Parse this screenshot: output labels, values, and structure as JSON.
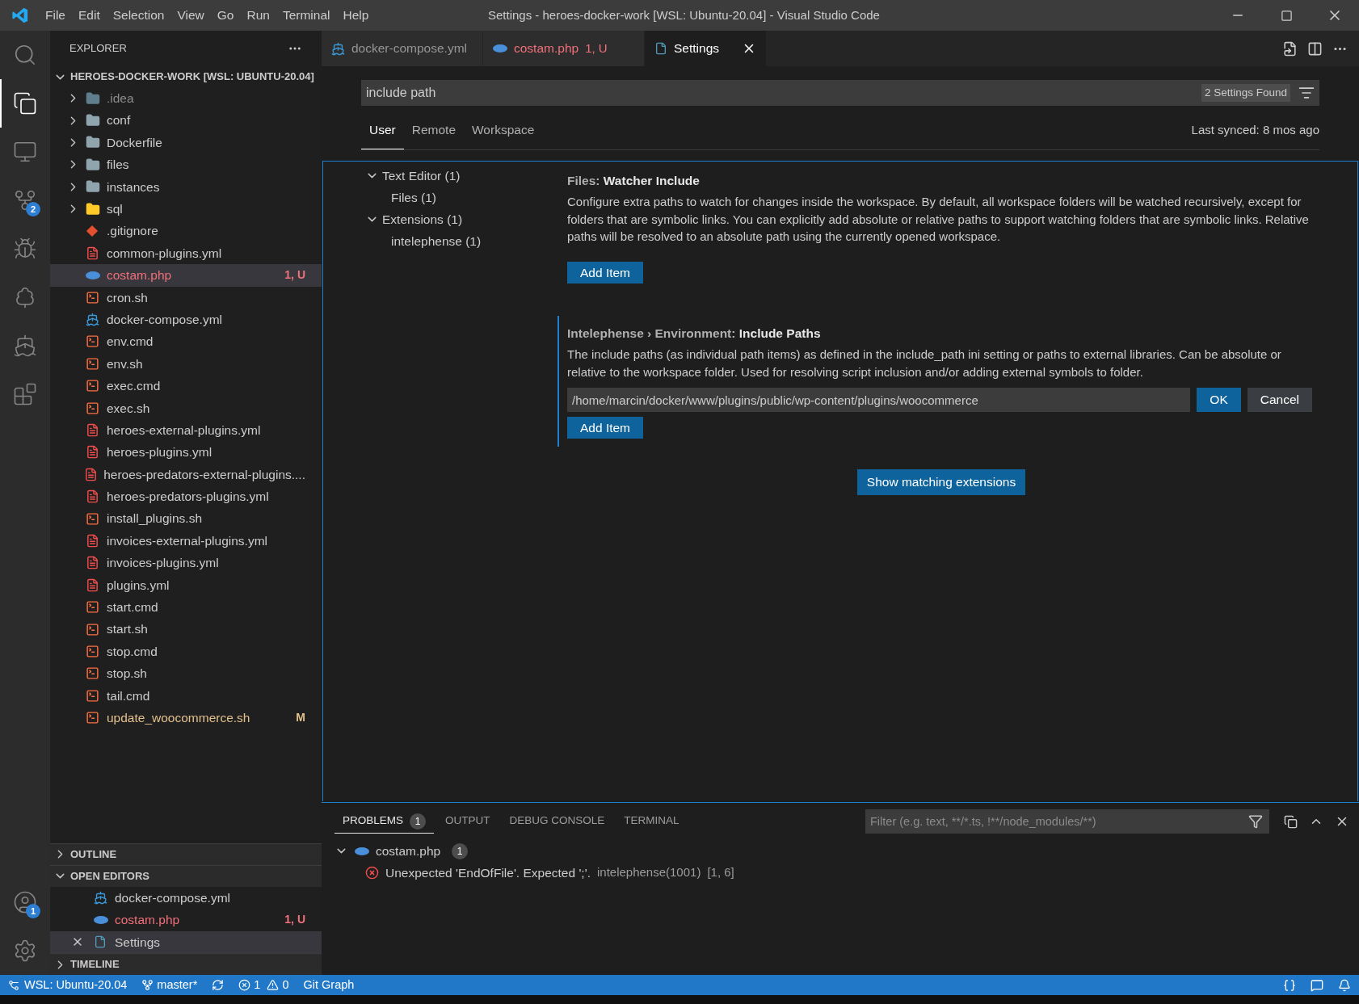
{
  "title_bar": {
    "menu": [
      "File",
      "Edit",
      "Selection",
      "View",
      "Go",
      "Run",
      "Terminal",
      "Help"
    ],
    "title": "Settings - heroes-docker-work [WSL: Ubuntu-20.04] - Visual Studio Code"
  },
  "activity_bar": {
    "items": [
      {
        "kind": "search",
        "selected": false
      },
      {
        "kind": "explorer",
        "selected": true
      },
      {
        "kind": "remote",
        "selected": false
      },
      {
        "kind": "source-control",
        "selected": false,
        "badge": "2"
      },
      {
        "kind": "run",
        "selected": false
      },
      {
        "kind": "testing",
        "selected": false
      },
      {
        "kind": "docker",
        "selected": false
      },
      {
        "kind": "extensions",
        "selected": false
      }
    ],
    "bottom": [
      {
        "kind": "accounts",
        "badge": "1"
      },
      {
        "kind": "manage"
      }
    ]
  },
  "explorer": {
    "title": "EXPLORER",
    "root": {
      "label": "HEROES-DOCKER-WORK [WSL: UBUNTU-20.04]",
      "expanded": true
    },
    "files": [
      {
        "name": ".idea",
        "kind": "idea-folder",
        "expanded": false,
        "color": "#8c8c8c",
        "selected": false
      },
      {
        "name": "conf",
        "kind": "folder",
        "expanded": false,
        "color": "#cccccc",
        "selected": false
      },
      {
        "name": "Dockerfile",
        "kind": "folder",
        "expanded": false,
        "color": "#cccccc",
        "selected": false
      },
      {
        "name": "files",
        "kind": "folder",
        "expanded": false,
        "color": "#cccccc",
        "selected": false
      },
      {
        "name": "instances",
        "kind": "folder",
        "expanded": false,
        "color": "#cccccc",
        "selected": false
      },
      {
        "name": "sql",
        "kind": "sql-folder",
        "expanded": false,
        "color": "#cccccc",
        "selected": false
      },
      {
        "name": ".gitignore",
        "kind": "git",
        "color": "#cccccc",
        "selected": false
      },
      {
        "name": "common-plugins.yml",
        "kind": "yaml",
        "color": "#cccccc",
        "selected": false
      },
      {
        "name": "costam.php",
        "kind": "php",
        "color": "#f1707b",
        "decoration": "1, U",
        "selected": true
      },
      {
        "name": "cron.sh",
        "kind": "shell",
        "color": "#cccccc",
        "selected": false
      },
      {
        "name": "docker-compose.yml",
        "kind": "docker",
        "color": "#cccccc",
        "selected": false
      },
      {
        "name": "env.cmd",
        "kind": "shell",
        "color": "#cccccc",
        "selected": false
      },
      {
        "name": "env.sh",
        "kind": "shell",
        "color": "#cccccc",
        "selected": false
      },
      {
        "name": "exec.cmd",
        "kind": "shell",
        "color": "#cccccc",
        "selected": false
      },
      {
        "name": "exec.sh",
        "kind": "shell",
        "color": "#cccccc",
        "selected": false
      },
      {
        "name": "heroes-external-plugins.yml",
        "kind": "yaml",
        "color": "#cccccc",
        "selected": false
      },
      {
        "name": "heroes-plugins.yml",
        "kind": "yaml",
        "color": "#cccccc",
        "selected": false
      },
      {
        "name": "heroes-predators-external-plugins....",
        "kind": "yaml",
        "color": "#cccccc",
        "selected": false
      },
      {
        "name": "heroes-predators-plugins.yml",
        "kind": "yaml",
        "color": "#cccccc",
        "selected": false
      },
      {
        "name": "install_plugins.sh",
        "kind": "shell",
        "color": "#cccccc",
        "selected": false
      },
      {
        "name": "invoices-external-plugins.yml",
        "kind": "yaml",
        "color": "#cccccc",
        "selected": false
      },
      {
        "name": "invoices-plugins.yml",
        "kind": "yaml",
        "color": "#cccccc",
        "selected": false
      },
      {
        "name": "plugins.yml",
        "kind": "yaml",
        "color": "#cccccc",
        "selected": false
      },
      {
        "name": "start.cmd",
        "kind": "shell",
        "color": "#cccccc",
        "selected": false
      },
      {
        "name": "start.sh",
        "kind": "shell",
        "color": "#cccccc",
        "selected": false
      },
      {
        "name": "stop.cmd",
        "kind": "shell",
        "color": "#cccccc",
        "selected": false
      },
      {
        "name": "stop.sh",
        "kind": "shell",
        "color": "#cccccc",
        "selected": false
      },
      {
        "name": "tail.cmd",
        "kind": "shell",
        "color": "#cccccc",
        "selected": false
      },
      {
        "name": "update_woocommerce.sh",
        "kind": "shell",
        "color": "#e2c08d",
        "decoration": "M",
        "selected": false
      }
    ]
  },
  "outline": {
    "label": "OUTLINE",
    "expanded": false
  },
  "open_editors": {
    "label": "OPEN EDITORS",
    "expanded": true,
    "items": [
      {
        "name": "docker-compose.yml",
        "kind": "docker",
        "color": "#cccccc",
        "selected": false
      },
      {
        "name": "costam.php",
        "kind": "php",
        "color": "#f1707b",
        "decoration": "1, U",
        "selected": false
      },
      {
        "name": "Settings",
        "kind": "settings",
        "color": "#cccccc",
        "selected": true
      }
    ]
  },
  "timeline": {
    "label": "TIMELINE",
    "expanded": false
  },
  "tabs": [
    {
      "label": "docker-compose.yml",
      "kind": "docker",
      "color": "#969696",
      "selected": false
    },
    {
      "label": "costam.php",
      "kind": "php",
      "color": "#f1707b",
      "decoration": "1, U",
      "selected": false
    },
    {
      "label": "Settings",
      "kind": "settings",
      "color": "#ffffff",
      "selected": true
    }
  ],
  "settings": {
    "search": {
      "value": "include path",
      "found": "2 Settings Found"
    },
    "scopes": [
      {
        "label": "User",
        "selected": true
      },
      {
        "label": "Remote",
        "selected": false
      },
      {
        "label": "Workspace",
        "selected": false
      }
    ],
    "last_synced": "Last synced: 8 mos ago",
    "toc": [
      {
        "label": "Text Editor (1)",
        "expanded": true,
        "children": [
          {
            "label": "Files (1)"
          }
        ]
      },
      {
        "label": "Extensions (1)",
        "expanded": true,
        "children": [
          {
            "label": "intelephense (1)"
          }
        ]
      }
    ],
    "items": [
      {
        "title": "Files: **Watcher Include**",
        "modified": false,
        "description": "Configure extra paths to watch for changes inside the workspace. By default, all workspace folders will be watched recursively, except for folders that are symbolic links. You can explicitly add absolute or relative paths to support watching folders that are symbolic links. Relative paths will be resolved to an absolute path using the currently opened workspace.",
        "add_label": "Add Item"
      },
      {
        "title": "Intelephense › Environment: **Include Paths**",
        "modified": true,
        "description": "The include paths (as individual path items) as defined in the include_path ini setting or paths to external libraries. Can be absolute or relative to the workspace folder. Used for resolving script inclusion and/or adding external symbols to folder.",
        "editing": {
          "value": "/home/marcin/docker/www/plugins/public/wp-content/plugins/woocommerce",
          "ok": "OK",
          "cancel": "Cancel"
        },
        "add_label": "Add Item"
      }
    ],
    "show_matching": "Show matching extensions"
  },
  "panel": {
    "tabs": [
      {
        "label": "PROBLEMS",
        "badge": "1",
        "selected": true
      },
      {
        "label": "OUTPUT",
        "selected": false
      },
      {
        "label": "DEBUG CONSOLE",
        "selected": false
      },
      {
        "label": "TERMINAL",
        "selected": false
      }
    ],
    "filter": {
      "placeholder": "Filter (e.g. text, **/*.ts, !**/node_modules/**)"
    },
    "problems": [
      {
        "file": "costam.php",
        "kind": "php",
        "count": "1",
        "expanded": true,
        "messages": [
          {
            "kind": "error",
            "message": "Unexpected 'EndOfFile'. Expected ';'.",
            "source": "intelephense(1001)",
            "position": "[1, 6]"
          }
        ]
      }
    ]
  },
  "status_bar": {
    "remote": "WSL: Ubuntu-20.04",
    "branch": "master*",
    "errors": "1",
    "warnings": "0",
    "git_graph": "Git Graph"
  }
}
